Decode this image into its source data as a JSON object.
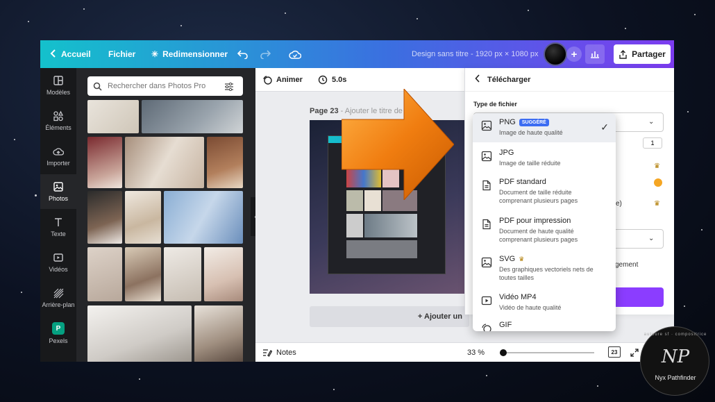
{
  "topbar": {
    "home_label": "Accueil",
    "file_label": "Fichier",
    "resize_label": "Redimensionner",
    "doc_title": "Design sans titre - 1920 px × 1080 px",
    "share_label": "Partager"
  },
  "rail": {
    "items": [
      {
        "label": "Modèles",
        "icon": "layout-icon"
      },
      {
        "label": "Éléments",
        "icon": "shapes-icon"
      },
      {
        "label": "Importer",
        "icon": "cloud-upload-icon"
      },
      {
        "label": "Photos",
        "icon": "image-icon"
      },
      {
        "label": "Texte",
        "icon": "text-icon"
      },
      {
        "label": "Vidéos",
        "icon": "video-icon"
      },
      {
        "label": "Arrière-plan",
        "icon": "hatch-icon"
      },
      {
        "label": "Pexels",
        "icon": "pexels-icon",
        "badge": "P"
      }
    ]
  },
  "photos_panel": {
    "search_placeholder": "Rechercher dans Photos Pro"
  },
  "editor": {
    "animate_label": "Animer",
    "duration": "5.0s",
    "page_label": "Page 23",
    "page_title_hint": "- Ajouter le titre de l",
    "add_page_label": "+ Ajouter un",
    "notes_label": "Notes",
    "zoom": "33 %",
    "page_count": "23"
  },
  "download": {
    "header": "Télécharger",
    "file_type_label": "Type de fichier",
    "size_value": "1",
    "paren_text": "e)",
    "checkbox_text": "gement",
    "options": [
      {
        "name": "PNG",
        "badge": "SUGGÉRÉ",
        "desc": [
          "Image de haute qualité"
        ],
        "icon": "image-icon",
        "selected": true
      },
      {
        "name": "JPG",
        "desc": [
          "Image de taille réduite"
        ],
        "icon": "image-icon"
      },
      {
        "name": "PDF standard",
        "desc": [
          "Document de taille réduite",
          "comprenant plusieurs pages"
        ],
        "icon": "document-icon"
      },
      {
        "name": "PDF pour impression",
        "desc": [
          "Document de haute qualité",
          "comprenant plusieurs pages"
        ],
        "icon": "document-icon"
      },
      {
        "name": "SVG",
        "crown": true,
        "desc": [
          "Des graphiques vectoriels nets de",
          "toutes tailles"
        ],
        "icon": "image-icon"
      },
      {
        "name": "Vidéo MP4",
        "desc": [
          "Vidéo de haute qualité"
        ],
        "icon": "video-icon"
      },
      {
        "name": "GIF",
        "desc": [],
        "icon": "gif-icon"
      }
    ]
  },
  "watermark": {
    "name": "Nyx Pathfinder",
    "monogram": "NP",
    "arc_text": "auteure sf · compositrice"
  },
  "colors": {
    "topbar_start": "#14c1cc",
    "topbar_mid": "#3b6fe0",
    "topbar_end": "#7d3cf0",
    "accent_purple": "#8b3dff",
    "suggested_badge": "#3c6cf2",
    "arrow_orange": "#f07d10"
  }
}
